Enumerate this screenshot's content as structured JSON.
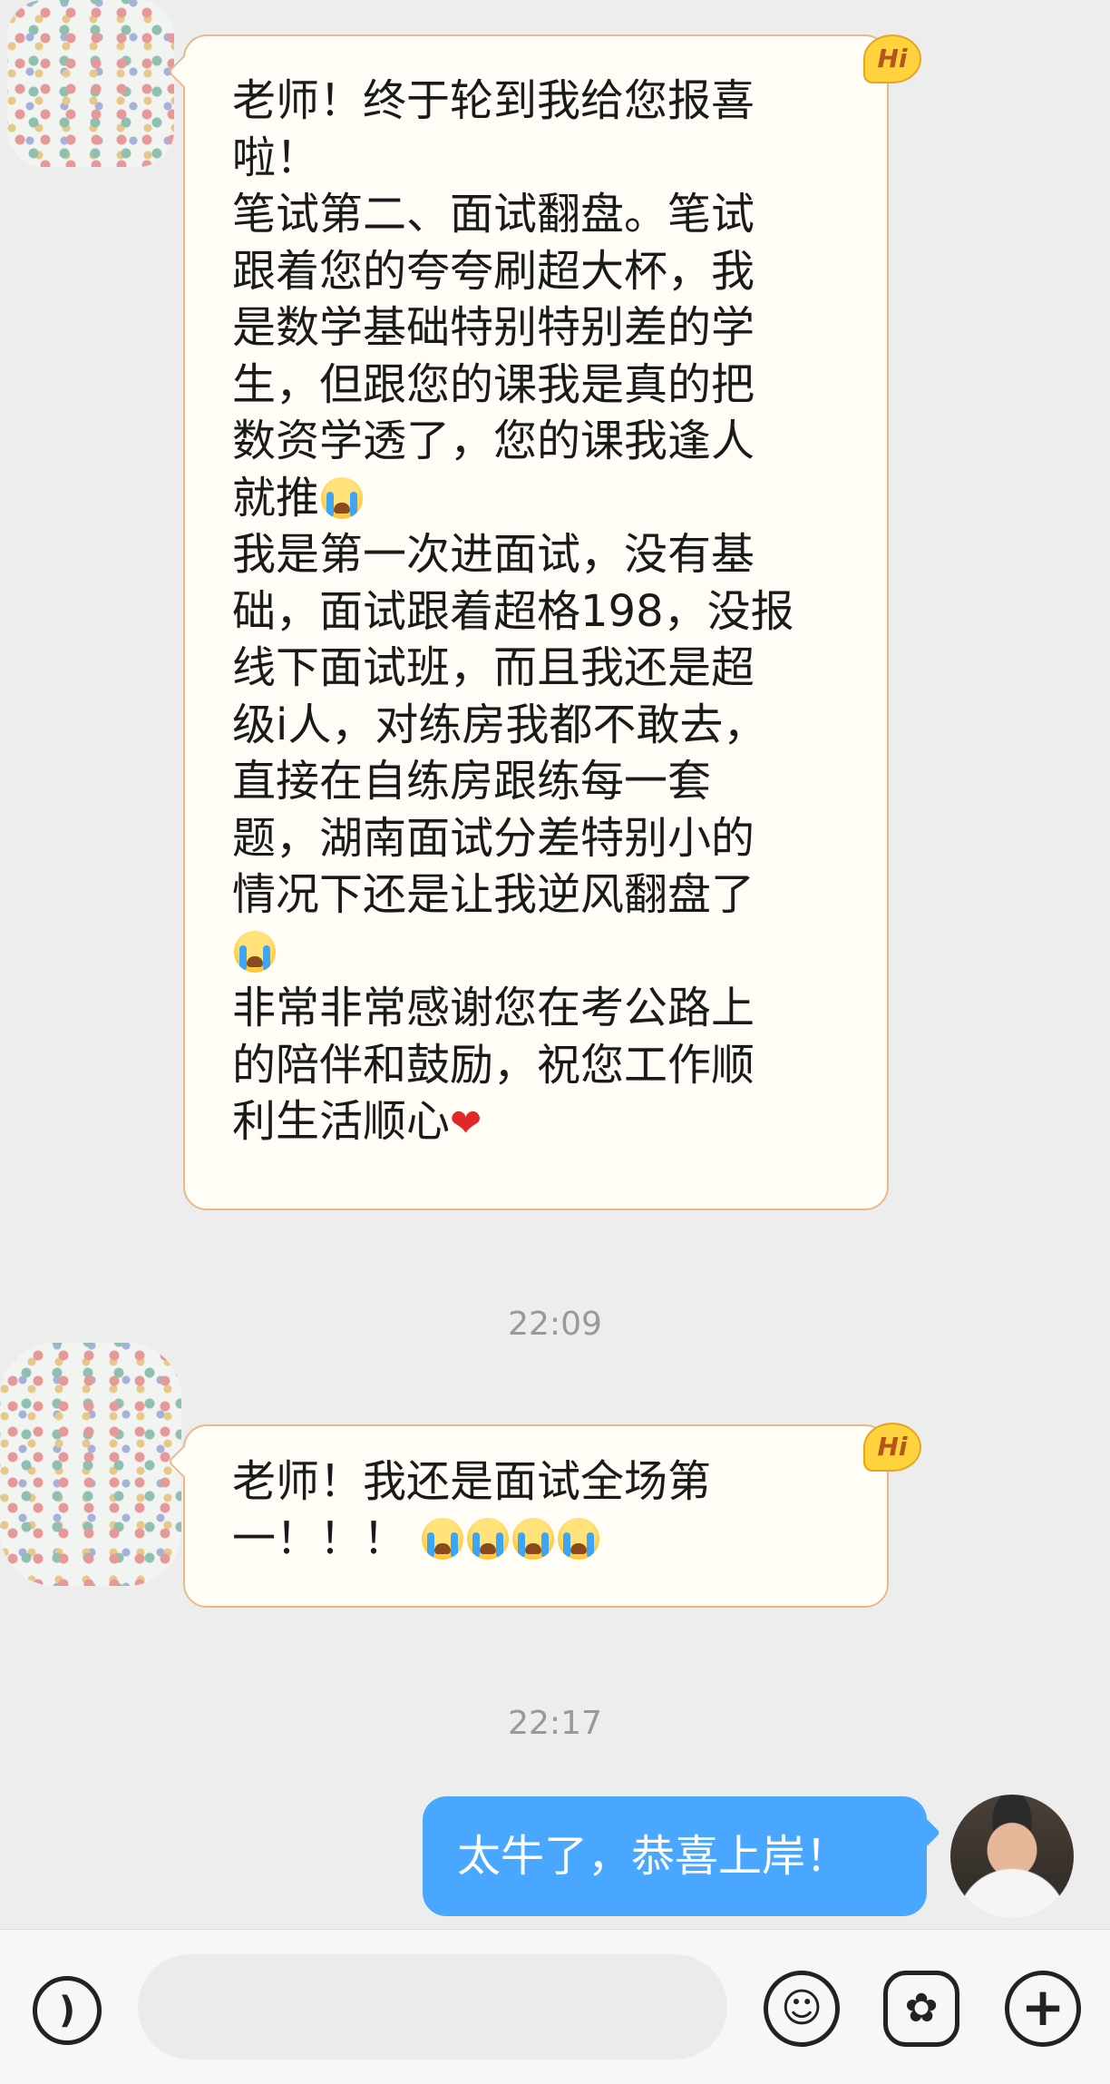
{
  "messages": [
    {
      "sender": "contact",
      "badge": "Hi",
      "text_lines": [
        "老师！终于轮到我给您报喜",
        "啦！",
        "笔试第二、面试翻盘。笔试",
        "跟着您的夸夸刷超大杯，我",
        "是数学基础特别特别差的学",
        "生，但跟您的课我是真的把",
        "数资学透了，您的课我逢人",
        "就推",
        "我是第一次进面试，没有基",
        "础，面试跟着超格198，没报",
        "线下面试班，而且我还是超",
        "级i人，对练房我都不敢去，",
        "直接在自练房跟练每一套",
        "题，湖南面试分差特别小的",
        "情况下还是让我逆风翻盘了",
        "",
        "非常非常感谢您在考公路上",
        "的陪伴和鼓励，祝您工作顺",
        "利生活顺心"
      ]
    },
    {
      "sender": "contact",
      "badge": "Hi",
      "text_lines": [
        "老师！我还是面试全场第",
        "一！！！"
      ]
    },
    {
      "sender": "me",
      "text": "太牛了，恭喜上岸！"
    }
  ],
  "timestamps": [
    "22:09",
    "22:17"
  ],
  "input": {
    "placeholder": "",
    "value": ""
  },
  "toolbar": {
    "voice_icon": "voice-icon",
    "emoji_icon": "emoji-icon",
    "sticker_icon": "sticker-icon",
    "plus_icon": "plus-icon",
    "plus_label": "+"
  },
  "colors": {
    "background": "#ededed",
    "contact_bubble": "#fffdf6",
    "contact_border": "#e9b98a",
    "my_bubble": "#4aa7ff",
    "timestamp": "#999999"
  }
}
